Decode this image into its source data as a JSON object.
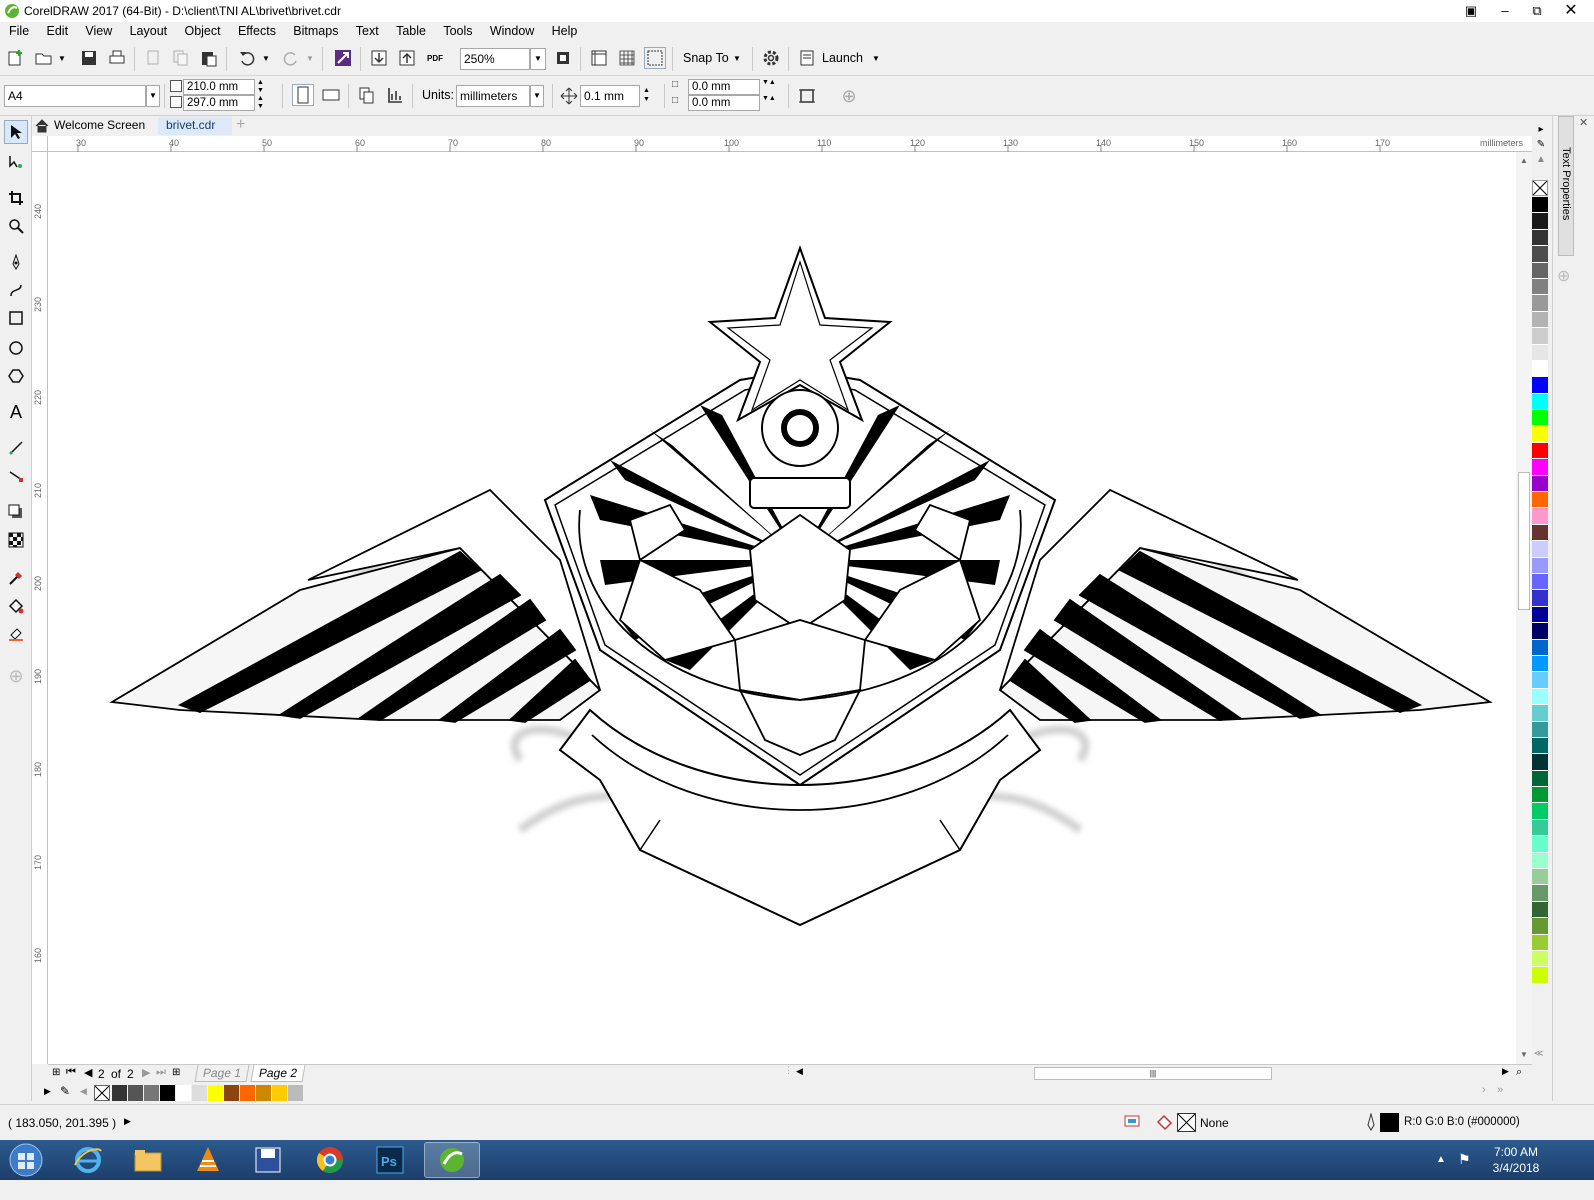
{
  "window": {
    "title": "CorelDRAW 2017 (64-Bit) - D:\\client\\TNI AL\\brivet\\brivet.cdr"
  },
  "menu": [
    "File",
    "Edit",
    "View",
    "Layout",
    "Object",
    "Effects",
    "Bitmaps",
    "Text",
    "Table",
    "Tools",
    "Window",
    "Help"
  ],
  "toolbar": {
    "zoom": "250%",
    "snap_to": "Snap To",
    "launch": "Launch"
  },
  "property_bar": {
    "page_size": "A4",
    "width": "210.0 mm",
    "height": "297.0 mm",
    "units_label": "Units:",
    "units": "millimeters",
    "nudge": "0.1 mm",
    "dup_x": "0.0 mm",
    "dup_y": "0.0 mm"
  },
  "tabs": {
    "welcome": "Welcome Screen",
    "document": "brivet.cdr"
  },
  "rulers": {
    "h_ticks": [
      "30",
      "40",
      "50",
      "60",
      "70",
      "80",
      "90",
      "100",
      "110",
      "120",
      "130",
      "140",
      "150",
      "160",
      "170"
    ],
    "h_unit": "millimeters",
    "v_ticks": [
      "240",
      "230",
      "220",
      "210",
      "200",
      "190",
      "180",
      "170",
      "160"
    ]
  },
  "docker": {
    "title": "Text Properties"
  },
  "pages": {
    "current": "2",
    "of_label": "of",
    "total": "2",
    "page1": "Page 1",
    "page2": "Page 2"
  },
  "status": {
    "coords": "( 183.050, 201.395 )",
    "fill": "None",
    "outline_color": "R:0 G:0 B:0 (#000000)"
  },
  "taskbar": {
    "time": "7:00 AM",
    "date": "3/4/2018"
  },
  "palette_colors": [
    "#000000",
    "#1a1a1a",
    "#333333",
    "#4d4d4d",
    "#666666",
    "#808080",
    "#999999",
    "#b3b3b3",
    "#cccccc",
    "#e6e6e6",
    "#ffffff",
    "#0000ff",
    "#00ffff",
    "#00ff00",
    "#ffff00",
    "#ff0000",
    "#ff00ff",
    "#9900cc",
    "#ff6600",
    "#ff99cc",
    "#663333",
    "#ccccff",
    "#9999ff",
    "#6666ff",
    "#3333cc",
    "#000099",
    "#000066",
    "#0066cc",
    "#0099ff",
    "#66ccff",
    "#99ffff",
    "#66cccc",
    "#339999",
    "#006666",
    "#003333",
    "#006633",
    "#009933",
    "#00cc66",
    "#33cc99",
    "#66ffcc",
    "#99ffcc",
    "#99cc99",
    "#669966",
    "#336633",
    "#669933",
    "#99cc33",
    "#ccff66",
    "#ccff00"
  ],
  "doc_palette_colors": [
    "#333333",
    "#555555",
    "#777777",
    "#000000",
    "#ffffff",
    "#dddddd",
    "#ffff00",
    "#8b4513",
    "#ff6600",
    "#cc8800",
    "#ffcc00",
    "#bbbbbb"
  ]
}
